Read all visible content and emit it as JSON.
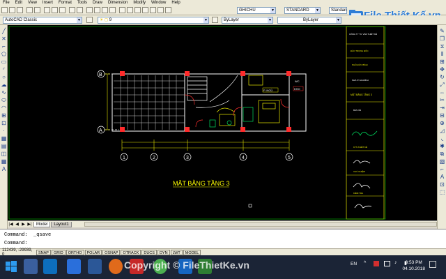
{
  "menubar": {
    "items": [
      "File",
      "Edit",
      "View",
      "Insert",
      "Format",
      "Tools",
      "Draw",
      "Dimension",
      "Modify",
      "Window",
      "Help"
    ]
  },
  "toolbar": {
    "text_style": "GHICHU",
    "dim_style": "STANDARD",
    "table_style": "Standard",
    "workspace": "AutoCAD Classic",
    "layer_value": "9",
    "color_value": "ByLayer",
    "linetype_value": "ByLayer"
  },
  "logo": {
    "text": "File Thiết Kế.vn"
  },
  "drawing": {
    "title": "MẶT BẰNG TẦNG 3",
    "grid_cols": [
      "1",
      "2",
      "3",
      "4",
      "5"
    ],
    "grid_rows": [
      "A",
      "B"
    ],
    "room_labels": [
      "P. NGỦ",
      "WC",
      "KHO"
    ],
    "title_block": {
      "rows": [
        "CÔNG TY TƯ VẤN THIẾT KẾ",
        "ĐÀO TRỌNG ĐỘC",
        "NGÔ ĐỨC BÌNH",
        "NHÀ Ở GIA ĐÌNH",
        "MẶT BẰNG TẦNG 3",
        "BẢN VẼ",
        "KTS THIẾT KẾ",
        "CHỦ NHIỆM",
        "KIỂM TRA"
      ]
    }
  },
  "tabs": {
    "items": [
      "Model",
      "Layout1"
    ],
    "active": "Model"
  },
  "command": {
    "line1_prefix": "Command:",
    "line1_value": "_qsave",
    "line2_prefix": "Command:"
  },
  "status": {
    "coordinates": "112439, -29939, 0",
    "toggles": [
      "SNAP",
      "GRID",
      "ORTHO",
      "POLAR",
      "OSNAP",
      "OTRACK",
      "DUCS",
      "DYN",
      "LWT",
      "MODEL"
    ]
  },
  "taskbar": {
    "language": "EN",
    "time": "3:53 PM",
    "date": "04.10.2018"
  },
  "watermark": "Copyright © FileThietKe.vn",
  "colors": {
    "canvas": "#000000",
    "drawing_lines": "#ffffff",
    "columns": "#ff2b2b",
    "dimension": "#ffff00",
    "taskbar": "#1b2436",
    "logo": "#2e7dd6"
  }
}
